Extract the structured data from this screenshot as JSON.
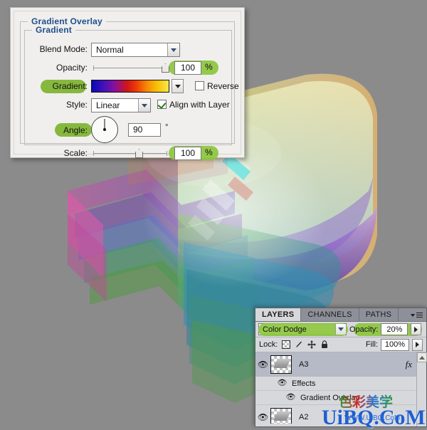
{
  "canvas": {
    "background_color": "#8b8b8c"
  },
  "dialog": {
    "title": "Gradient Overlay",
    "group_title": "Gradient",
    "rows": {
      "blend_mode": {
        "label": "Blend Mode:",
        "value": "Normal"
      },
      "opacity": {
        "label": "Opacity:",
        "value": "100",
        "unit": "%"
      },
      "gradient": {
        "label": "Gradient:",
        "reverse_label": "Reverse",
        "reverse_checked": false
      },
      "style": {
        "label": "Style:",
        "value": "Linear",
        "align_label": "Align with Layer",
        "align_checked": true
      },
      "angle": {
        "label": "Angle:",
        "value": "90",
        "unit": "°"
      },
      "scale": {
        "label": "Scale:",
        "value": "100",
        "unit": "%"
      }
    },
    "gradient_stops": [
      "#0a0ab4",
      "#4412b8",
      "#8a0f9a",
      "#d01616",
      "#ee3c06",
      "#f78b06",
      "#f8c40a",
      "#f5e84a"
    ],
    "highlight_color": "#8cc63e"
  },
  "layers_panel": {
    "tabs": [
      {
        "label": "LAYERS",
        "active": true
      },
      {
        "label": "CHANNELS",
        "active": false
      },
      {
        "label": "PATHS",
        "active": false
      }
    ],
    "menu_icon": "panel-menu-icon",
    "blend_mode": "Color Dodge",
    "opacity_label": "Opacity:",
    "opacity_value": "20%",
    "lock_label": "Lock:",
    "lock_icons": [
      "lock-transparency-icon",
      "lock-image-icon",
      "lock-position-icon",
      "lock-all-icon"
    ],
    "fill_label": "Fill:",
    "fill_value": "100%",
    "layers": [
      {
        "name": "A3",
        "visible": true,
        "selected": true,
        "fx_label": "fx",
        "effects": [
          {
            "name": "Effects",
            "visible": true
          },
          {
            "name": "Gradient Overlay",
            "visible": true
          }
        ]
      },
      {
        "name": "A2",
        "visible": true,
        "selected": false,
        "effects": []
      }
    ]
  },
  "watermark": {
    "main": "UiBQ.CoM",
    "sub": "WWW.UiBQ.CoM",
    "cn": "色彩美学"
  }
}
